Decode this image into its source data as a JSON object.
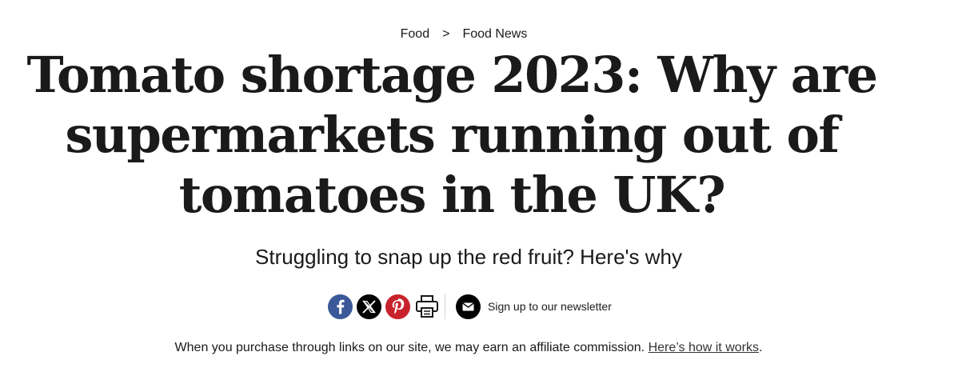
{
  "breadcrumb": {
    "items": [
      "Food",
      "Food News"
    ],
    "separator": ">"
  },
  "article": {
    "headline_lines": [
      "Tomato shortage 2023: Why are",
      "supermarkets running out of",
      "tomatoes in the UK?"
    ],
    "subtitle": "Struggling to snap up the red fruit? Here's why"
  },
  "share": {
    "icons": [
      "facebook-icon",
      "x-twitter-icon",
      "pinterest-icon",
      "print-icon",
      "mail-icon"
    ],
    "colors": {
      "facebook": "#3b5998",
      "x": "#000000",
      "pinterest": "#c8232c"
    },
    "newsletter_label": "Sign up to our newsletter"
  },
  "affiliate": {
    "text": "When you purchase through links on our site, we may earn an affiliate commission.",
    "link_text": "Here’s how it works",
    "end": "."
  }
}
